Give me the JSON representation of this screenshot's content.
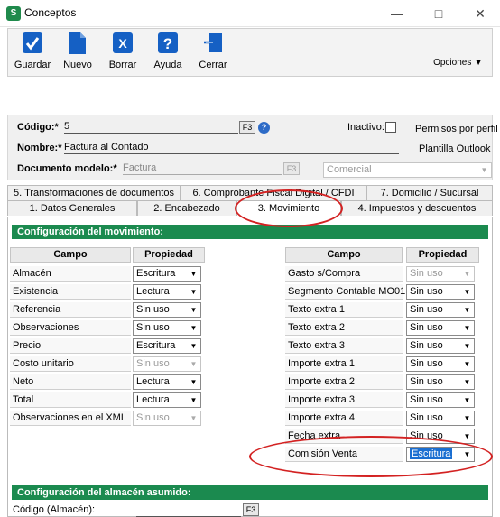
{
  "window": {
    "title": "Conceptos",
    "app_icon": "S"
  },
  "toolbar": {
    "buttons": [
      {
        "label": "Guardar",
        "icon": "check-icon"
      },
      {
        "label": "Nuevo",
        "icon": "new-document-icon"
      },
      {
        "label": "Borrar",
        "icon": "delete-icon"
      },
      {
        "label": "Ayuda",
        "icon": "help-icon"
      },
      {
        "label": "Cerrar",
        "icon": "exit-icon"
      }
    ],
    "opciones": "Opciones ▼"
  },
  "form": {
    "codigo_label": "Código:*",
    "codigo_value": "5",
    "nombre_label": "Nombre:*",
    "nombre_value": "Factura al Contado",
    "docmodelo_label": "Documento modelo:*",
    "docmodelo_value": "Factura",
    "f3": "F3",
    "inactivo_label": "Inactivo:",
    "permisos": "Permisos por perfil",
    "plantilla": "Plantilla Outlook",
    "comercial": "Comercial"
  },
  "tabs_top": [
    "5. Transformaciones de documentos",
    "6. Comprobante Fiscal Digital / CFDI",
    "7. Domicilio / Sucursal"
  ],
  "tabs_bottom": [
    "1. Datos Generales",
    "2. Encabezado",
    "3. Movimiento",
    "4. Impuestos y descuentos"
  ],
  "movimiento": {
    "header": "Configuración del movimiento:",
    "col_campo": "Campo",
    "col_propiedad": "Propiedad",
    "left_rows": [
      {
        "campo": "Almacén",
        "prop": "Escritura",
        "disabled": false
      },
      {
        "campo": "Existencia",
        "prop": "Lectura",
        "disabled": false
      },
      {
        "campo": "Referencia",
        "prop": "Sin uso",
        "disabled": false
      },
      {
        "campo": "Observaciones",
        "prop": "Sin uso",
        "disabled": false
      },
      {
        "campo": "Precio",
        "prop": "Escritura",
        "disabled": false
      },
      {
        "campo": "Costo unitario",
        "prop": "Sin uso",
        "disabled": true
      },
      {
        "campo": "Neto",
        "prop": "Lectura",
        "disabled": false
      },
      {
        "campo": "Total",
        "prop": "Lectura",
        "disabled": false
      },
      {
        "campo": "Observaciones en el XML",
        "prop": "Sin uso",
        "disabled": true
      }
    ],
    "right_rows": [
      {
        "campo": "Gasto s/Compra",
        "prop": "Sin uso",
        "disabled": true
      },
      {
        "campo": "Segmento Contable MO01",
        "prop": "Sin uso",
        "disabled": false
      },
      {
        "campo": "Texto extra 1",
        "prop": "Sin uso",
        "disabled": false
      },
      {
        "campo": "Texto extra 2",
        "prop": "Sin uso",
        "disabled": false
      },
      {
        "campo": "Texto extra 3",
        "prop": "Sin uso",
        "disabled": false
      },
      {
        "campo": "Importe extra 1",
        "prop": "Sin uso",
        "disabled": false
      },
      {
        "campo": "Importe extra 2",
        "prop": "Sin uso",
        "disabled": false
      },
      {
        "campo": "Importe extra 3",
        "prop": "Sin uso",
        "disabled": false
      },
      {
        "campo": "Importe extra 4",
        "prop": "Sin uso",
        "disabled": false
      },
      {
        "campo": "Fecha extra",
        "prop": "Sin uso",
        "disabled": false
      },
      {
        "campo": "Comisión Venta",
        "prop": "Escritura",
        "disabled": false,
        "focus": true
      }
    ]
  },
  "almacen": {
    "header": "Configuración del almacén asumido:",
    "codigo_label": "Código (Almacén):",
    "f3": "F3"
  },
  "colors": {
    "accent": "#1b8a4f",
    "annotation": "#d32222"
  }
}
